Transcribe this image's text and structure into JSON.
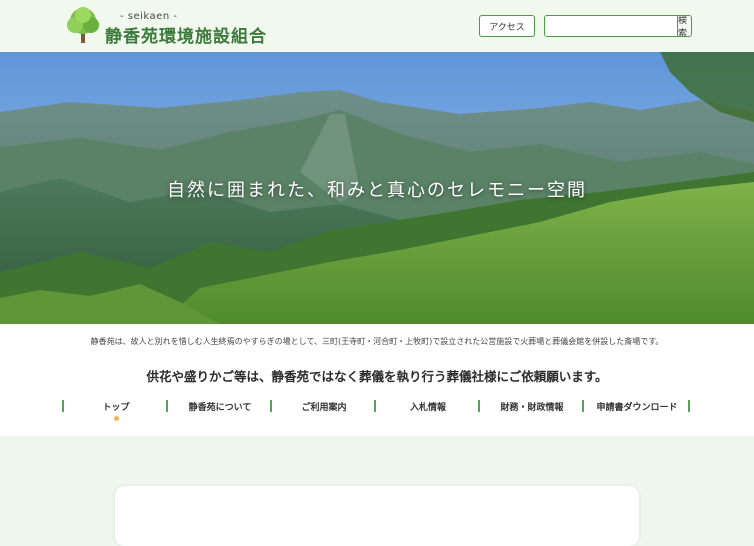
{
  "header": {
    "site_sub": "- seikaen -",
    "site_name": "静香苑環境施設組合",
    "access_label": "アクセス",
    "search_placeholder": "",
    "search_value": "",
    "search_button": "検索",
    "logo_icon": "tree-icon"
  },
  "hero": {
    "tagline": "自然に囲まれた、和みと真心のセレモニー空間"
  },
  "main": {
    "intro": "静香苑は、故人と別れを惜しむ人生終焉のやすらぎの場として、三町(王寺町・河合町・上牧町)で設立された公営施設で火葬場と葬儀会館を併設した斎場です。",
    "notice": "供花や盛りかご等は、静香苑ではなく葬儀を執り行う葬儀社様にご依頼願います。"
  },
  "nav": {
    "items": [
      {
        "label": "トップ"
      },
      {
        "label": "静香苑について"
      },
      {
        "label": "ご利用案内"
      },
      {
        "label": "入札情報"
      },
      {
        "label": "財務・財政情報"
      },
      {
        "label": "申請書ダウンロード"
      }
    ]
  },
  "colors": {
    "accent": "#4c9a4c",
    "brand_text": "#3b7a3b",
    "header_bg": "#f1f8ee",
    "page_bg": "#eef6ee",
    "active_dot": "#f0b84a"
  }
}
